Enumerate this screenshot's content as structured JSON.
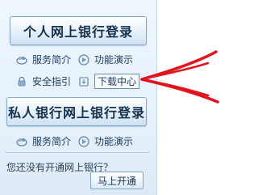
{
  "personal_login": {
    "label": "个人网上银行登录",
    "links": [
      {
        "label": "服务简介",
        "icon": "service-icon"
      },
      {
        "label": "功能演示",
        "icon": "demo-icon"
      },
      {
        "label": "安全指引",
        "icon": "lock-icon"
      },
      {
        "label": "下载中心",
        "icon": "download-icon"
      }
    ]
  },
  "private_login": {
    "label": "私人银行网上银行登录",
    "links": [
      {
        "label": "服务简介",
        "icon": "service-icon"
      },
      {
        "label": "功能演示",
        "icon": "demo-icon"
      }
    ]
  },
  "footer": {
    "question": "您还没有开通网上银行？",
    "open_button": "马上开通"
  },
  "annotation": {
    "arrow_color": "#e3121b",
    "target": "下载中心"
  }
}
